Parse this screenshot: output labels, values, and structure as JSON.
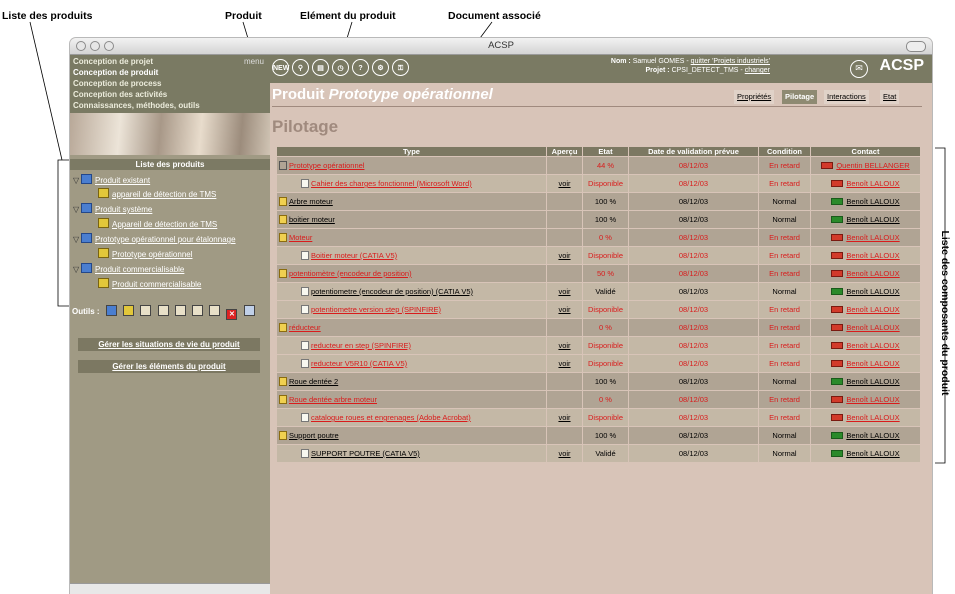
{
  "annotations": {
    "liste_produits": "Liste des produits",
    "produit": "Produit",
    "element_produit": "Elément du produit",
    "document_associe": "Document associé",
    "liste_composants": "Liste des composants du produit"
  },
  "window": {
    "title": "ACSP"
  },
  "sidebar": {
    "menu_label": "menu",
    "menu_items": [
      "Conception de projet",
      "Conception de produit",
      "Conception de process",
      "Conception des activités",
      "Connaissances, méthodes, outils"
    ],
    "list_header": "Liste des produits",
    "tree": [
      {
        "level": 0,
        "icon": "folder-icon",
        "label": "Produit existant"
      },
      {
        "level": 1,
        "icon": "product-icon",
        "label": "appareil de détection de TMS"
      },
      {
        "level": 0,
        "icon": "folder-icon",
        "label": "Produit système"
      },
      {
        "level": 1,
        "icon": "product-icon",
        "label": "Appareil de détection de TMS"
      },
      {
        "level": 0,
        "icon": "folder-icon",
        "label": "Prototype opérationnel pour étalonnage"
      },
      {
        "level": 1,
        "icon": "product-icon",
        "label": "Prototype opérationnel"
      },
      {
        "level": 0,
        "icon": "folder-icon",
        "label": "Produit commercialisable"
      },
      {
        "level": 1,
        "icon": "product-icon",
        "label": "Produit commercialisable"
      }
    ],
    "tools_label": "Outils :",
    "buttons": [
      "Gérer les situations de vie du produit",
      "Gérer les éléments du produit"
    ]
  },
  "header": {
    "toolbar_icons": [
      "new-icon",
      "search-icon",
      "print-icon",
      "history-icon",
      "help-icon",
      "settings-icon",
      "key-icon"
    ],
    "nom_label": "Nom :",
    "user": "Samuel GOMES",
    "quitter": "quitter 'Projets industriels'",
    "projet_label": "Projet :",
    "projet": "CPSI_DETECT_TMS",
    "changer": "changer",
    "logo": "ACSP"
  },
  "page": {
    "title_prefix": "Produit",
    "title_name": "Prototype opérationnel",
    "tabs": [
      "Propriétés",
      "Pilotage",
      "Interactions",
      "Etat"
    ],
    "active_tab": "Pilotage",
    "section": "Pilotage"
  },
  "table": {
    "headers": [
      "Type",
      "Aperçu",
      "Etat",
      "Date de validation prévue",
      "Condition",
      "Contact"
    ],
    "rows": [
      {
        "indent": 0,
        "icon": "product",
        "name": "Prototype opérationnel",
        "red": true,
        "apercu": "",
        "etat": "44 %",
        "etat_red": true,
        "date": "08/12/03",
        "date_red": true,
        "condition": "En retard",
        "cond_red": true,
        "contact": "Quentin BELLANGER",
        "contact_red": true
      },
      {
        "indent": 1,
        "icon": "doc",
        "name": "Cahier des charges fonctionnel (Microsoft Word)",
        "red": true,
        "apercu": "voir",
        "etat": "Disponible",
        "etat_red": true,
        "date": "08/12/03",
        "date_red": true,
        "condition": "En retard",
        "cond_red": true,
        "contact": "Benoît LALOUX",
        "contact_red": true
      },
      {
        "indent": 0,
        "icon": "comp",
        "name": "Arbre moteur",
        "red": false,
        "apercu": "",
        "etat": "100 %",
        "etat_red": false,
        "date": "08/12/03",
        "date_red": false,
        "condition": "Normal",
        "cond_red": false,
        "contact": "Benoît LALOUX",
        "contact_red": false
      },
      {
        "indent": 0,
        "icon": "comp",
        "name": "boitier moteur",
        "red": false,
        "apercu": "",
        "etat": "100 %",
        "etat_red": false,
        "date": "08/12/03",
        "date_red": false,
        "condition": "Normal",
        "cond_red": false,
        "contact": "Benoît LALOUX",
        "contact_red": false
      },
      {
        "indent": 0,
        "icon": "comp",
        "name": "Moteur",
        "red": true,
        "apercu": "",
        "etat": "0 %",
        "etat_red": true,
        "date": "08/12/03",
        "date_red": true,
        "condition": "En retard",
        "cond_red": true,
        "contact": "Benoît LALOUX",
        "contact_red": true
      },
      {
        "indent": 1,
        "icon": "doc",
        "name": "Boitier moteur (CATIA V5)",
        "red": true,
        "apercu": "voir",
        "etat": "Disponible",
        "etat_red": true,
        "date": "08/12/03",
        "date_red": true,
        "condition": "En retard",
        "cond_red": true,
        "contact": "Benoît LALOUX",
        "contact_red": true
      },
      {
        "indent": 0,
        "icon": "comp",
        "name": "potentiomètre (encodeur de position)",
        "red": true,
        "apercu": "",
        "etat": "50 %",
        "etat_red": true,
        "date": "08/12/03",
        "date_red": true,
        "condition": "En retard",
        "cond_red": true,
        "contact": "Benoît LALOUX",
        "contact_red": true
      },
      {
        "indent": 1,
        "icon": "doc",
        "name": "potentiometre (encodeur de position) (CATIA V5)",
        "red": false,
        "apercu": "voir",
        "etat": "Validé",
        "etat_red": false,
        "date": "08/12/03",
        "date_red": false,
        "condition": "Normal",
        "cond_red": false,
        "contact": "Benoît LALOUX",
        "contact_red": false
      },
      {
        "indent": 1,
        "icon": "doc",
        "name": "potentiometre version step (SPINFIRE)",
        "red": true,
        "apercu": "voir",
        "etat": "Disponible",
        "etat_red": true,
        "date": "08/12/03",
        "date_red": true,
        "condition": "En retard",
        "cond_red": true,
        "contact": "Benoît LALOUX",
        "contact_red": true
      },
      {
        "indent": 0,
        "icon": "comp",
        "name": "réducteur",
        "red": true,
        "apercu": "",
        "etat": "0 %",
        "etat_red": true,
        "date": "08/12/03",
        "date_red": true,
        "condition": "En retard",
        "cond_red": true,
        "contact": "Benoît LALOUX",
        "contact_red": true
      },
      {
        "indent": 1,
        "icon": "doc",
        "name": "reducteur en step (SPINFIRE)",
        "red": true,
        "apercu": "voir",
        "etat": "Disponible",
        "etat_red": true,
        "date": "08/12/03",
        "date_red": true,
        "condition": "En retard",
        "cond_red": true,
        "contact": "Benoît LALOUX",
        "contact_red": true
      },
      {
        "indent": 1,
        "icon": "doc",
        "name": "reducteur V5R10 (CATIA V5)",
        "red": true,
        "apercu": "voir",
        "etat": "Disponible",
        "etat_red": true,
        "date": "08/12/03",
        "date_red": true,
        "condition": "En retard",
        "cond_red": true,
        "contact": "Benoît LALOUX",
        "contact_red": true
      },
      {
        "indent": 0,
        "icon": "comp",
        "name": "Roue dentée 2",
        "red": false,
        "apercu": "",
        "etat": "100 %",
        "etat_red": false,
        "date": "08/12/03",
        "date_red": false,
        "condition": "Normal",
        "cond_red": false,
        "contact": "Benoît LALOUX",
        "contact_red": false
      },
      {
        "indent": 0,
        "icon": "comp",
        "name": "Roue dentée arbre moteur",
        "red": true,
        "apercu": "",
        "etat": "0 %",
        "etat_red": true,
        "date": "08/12/03",
        "date_red": true,
        "condition": "En retard",
        "cond_red": true,
        "contact": "Benoît LALOUX",
        "contact_red": true
      },
      {
        "indent": 1,
        "icon": "doc",
        "name": "catalogue roues et engrenages (Adobe Acrobat)",
        "red": true,
        "apercu": "voir",
        "etat": "Disponible",
        "etat_red": true,
        "date": "08/12/03",
        "date_red": true,
        "condition": "En retard",
        "cond_red": true,
        "contact": "Benoît LALOUX",
        "contact_red": true
      },
      {
        "indent": 0,
        "icon": "comp",
        "name": "Support poutre",
        "red": false,
        "apercu": "",
        "etat": "100 %",
        "etat_red": false,
        "date": "08/12/03",
        "date_red": false,
        "condition": "Normal",
        "cond_red": false,
        "contact": "Benoît LALOUX",
        "contact_red": false
      },
      {
        "indent": 1,
        "icon": "doc",
        "name": "SUPPORT POUTRE (CATIA V5)",
        "red": false,
        "apercu": "voir",
        "etat": "Validé",
        "etat_red": false,
        "date": "08/12/03",
        "date_red": false,
        "condition": "Normal",
        "cond_red": false,
        "contact": "Benoît LALOUX",
        "contact_red": false
      }
    ]
  }
}
